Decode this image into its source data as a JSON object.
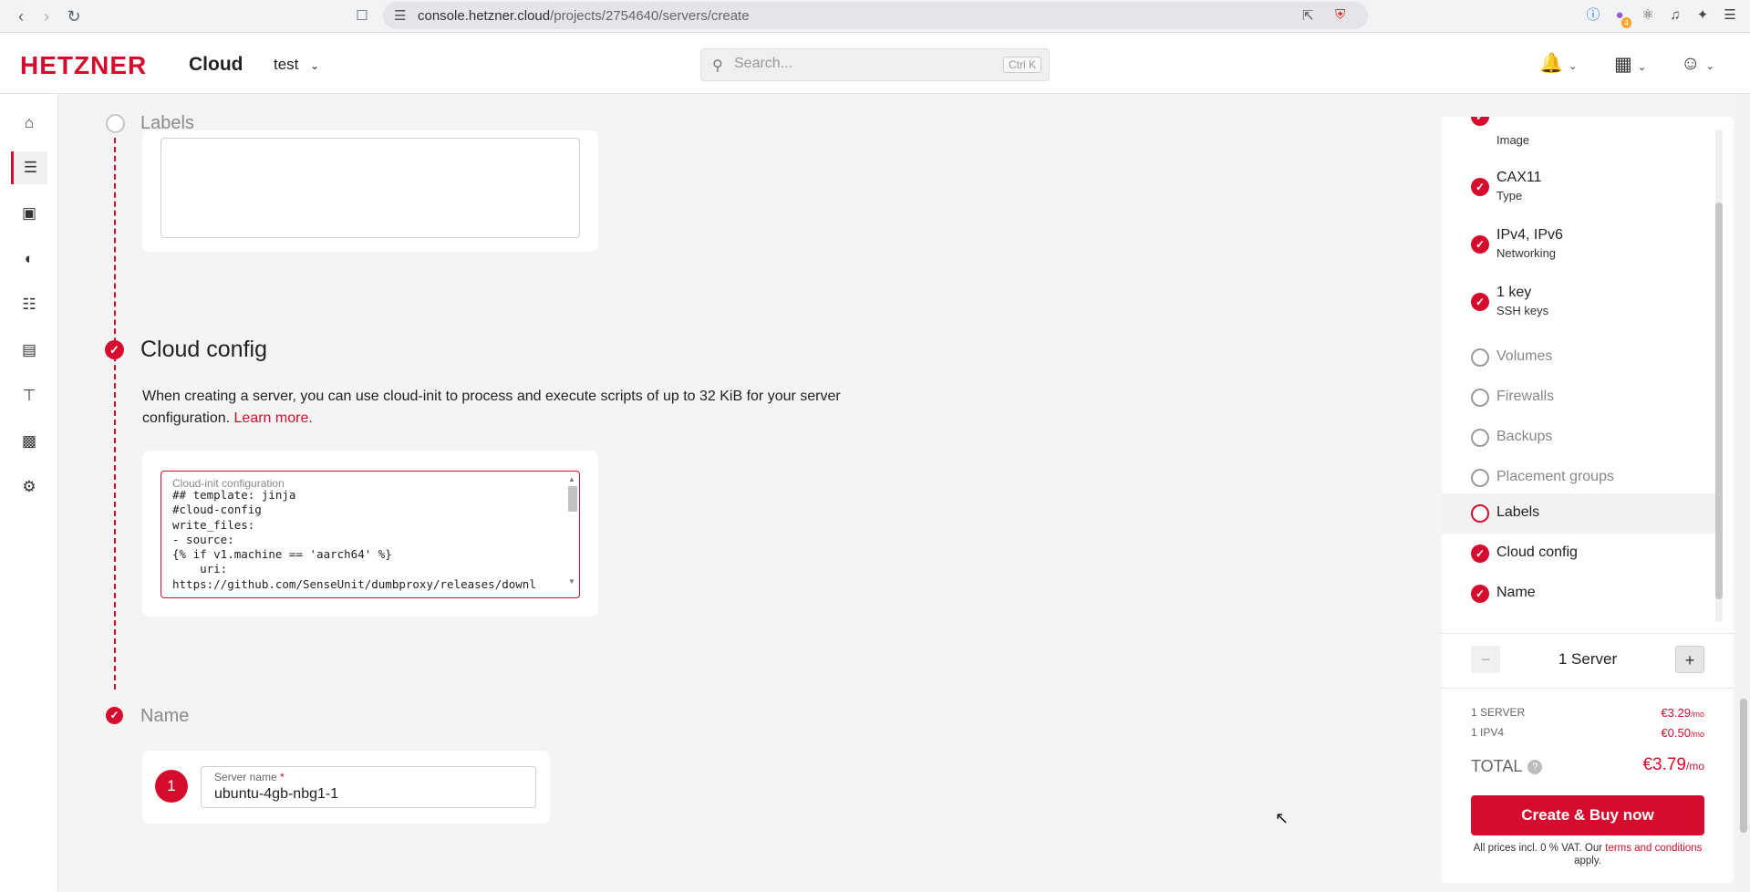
{
  "browser": {
    "url_host": "console.hetzner.cloud",
    "url_path": "/projects/2754640/servers/create",
    "extension_badge": "4"
  },
  "header": {
    "logo": "HETZNER",
    "product": "Cloud",
    "project": "test",
    "search_placeholder": "Search...",
    "search_shortcut": "Ctrl K"
  },
  "main": {
    "labels_step": {
      "title": "Labels"
    },
    "cloud_config": {
      "title": "Cloud config",
      "description": "When creating a server, you can use cloud-init to process and execute scripts of up to 32 KiB for your server configuration.",
      "learn_more": "Learn more.",
      "field_label": "Cloud-init configuration",
      "code": "## template: jinja\n#cloud-config\nwrite_files:\n- source:\n{% if v1.machine == 'aarch64' %}\n    uri:\nhttps://github.com/SenseUnit/dumbproxy/releases/downl"
    },
    "name_step": {
      "title": "Name",
      "badge": "1",
      "field_label": "Server name",
      "required_mark": "*",
      "value": "ubuntu-4gb-nbg1-1"
    }
  },
  "summary": {
    "items": [
      {
        "label": "",
        "sub": "Image",
        "state": "done"
      },
      {
        "label": "CAX11",
        "sub": "Type",
        "state": "done"
      },
      {
        "label": "IPv4, IPv6",
        "sub": "Networking",
        "state": "done"
      },
      {
        "label": "1 key",
        "sub": "SSH keys",
        "state": "done"
      },
      {
        "label": "Volumes",
        "state": "empty"
      },
      {
        "label": "Firewalls",
        "state": "empty"
      },
      {
        "label": "Backups",
        "state": "empty"
      },
      {
        "label": "Placement groups",
        "state": "empty"
      },
      {
        "label": "Labels",
        "state": "active"
      },
      {
        "label": "Cloud config",
        "state": "done"
      },
      {
        "label": "Name",
        "state": "done"
      }
    ],
    "quantity": {
      "minus": "−",
      "label": "1 Server",
      "plus": "+"
    },
    "prices": [
      {
        "label": "1 SERVER",
        "amount": "€3.29",
        "unit": "/mo"
      },
      {
        "label": "1 IPV4",
        "amount": "€0.50",
        "unit": "/mo"
      }
    ],
    "total": {
      "label": "TOTAL",
      "help": "?",
      "amount": "€3.79",
      "unit": "/mo"
    },
    "buy_label": "Create & Buy now",
    "vat_note_prefix": "All prices incl. 0 % VAT. Our",
    "terms_link": "terms and conditions",
    "vat_note_suffix": "apply."
  },
  "colors": {
    "brand": "#d50c2d",
    "background": "#f4f4f4"
  },
  "icons": {
    "browser": [
      "back-icon",
      "forward-icon",
      "reload-icon",
      "bookmark-icon",
      "site-info-icon",
      "share-icon",
      "brave-shield-icon"
    ],
    "header": [
      "chevron-down-icon",
      "search-icon",
      "bell-icon",
      "apps-grid-icon",
      "user-icon"
    ],
    "sidebar": [
      "home-icon",
      "servers-icon",
      "box-icon",
      "bucket-icon",
      "network-icon",
      "storage-icon",
      "load-balancer-icon",
      "robot-icon",
      "key-icon"
    ]
  }
}
